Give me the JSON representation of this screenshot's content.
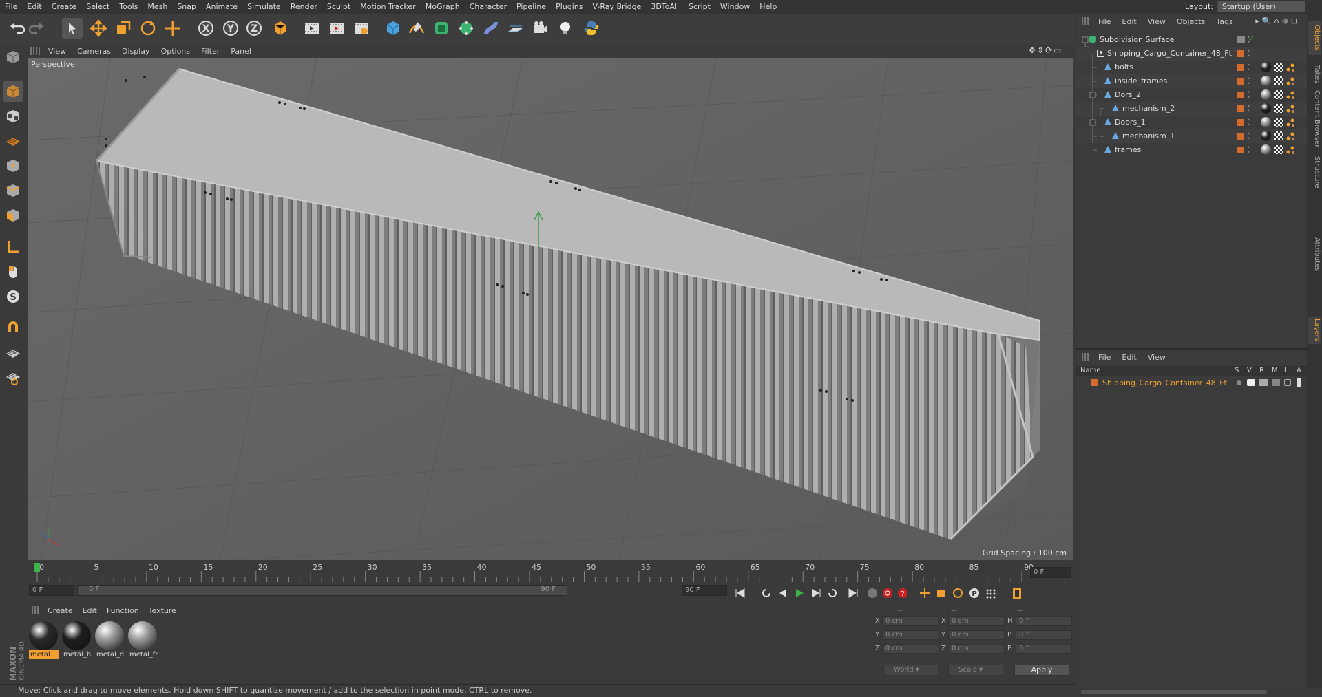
{
  "menubar": {
    "items": [
      "File",
      "Edit",
      "Create",
      "Select",
      "Tools",
      "Mesh",
      "Snap",
      "Animate",
      "Simulate",
      "Render",
      "Sculpt",
      "Motion Tracker",
      "MoGraph",
      "Character",
      "Pipeline",
      "Plugins",
      "V-Ray Bridge",
      "3DToAll",
      "Script",
      "Window",
      "Help"
    ],
    "layout_label": "Layout:",
    "layout_value": "Startup (User)"
  },
  "toolbar": {
    "icons": [
      "undo-icon",
      "redo-icon",
      "select-pointer-icon",
      "move-icon",
      "scale-icon",
      "rotate-icon",
      "transform-icon",
      "x-axis-lock-icon",
      "y-axis-lock-icon",
      "z-axis-lock-icon",
      "world-coord-icon",
      "render-view-icon",
      "render-picture-viewer-icon",
      "render-settings-icon",
      "cube-primitive-icon",
      "pen-spline-icon",
      "subdivision-nurbs-icon",
      "array-mograph-icon",
      "deformer-icon",
      "floor-environment-icon",
      "camera-icon",
      "light-icon",
      "python-icon"
    ],
    "axis_labels": [
      "X",
      "Y",
      "Z"
    ]
  },
  "viewport": {
    "menu": [
      "View",
      "Cameras",
      "Display",
      "Options",
      "Filter",
      "Panel"
    ],
    "label": "Perspective",
    "grid_spacing": "Grid Spacing : 100 cm"
  },
  "timeline": {
    "ticks": [
      "0",
      "5",
      "10",
      "15",
      "20",
      "25",
      "30",
      "35",
      "40",
      "45",
      "50",
      "55",
      "60",
      "65",
      "70",
      "75",
      "80",
      "85",
      "90"
    ],
    "current_frame": "0 F"
  },
  "playbar": {
    "start": "0 F",
    "range_start": "0 F",
    "range_end": "90 F",
    "end": "90 F"
  },
  "materials": {
    "menu": [
      "Create",
      "Edit",
      "Function",
      "Texture"
    ],
    "items": [
      {
        "name": "metal",
        "color": "#2a2a2a",
        "selected": true
      },
      {
        "name": "metal_b",
        "color": "#1e1e1e",
        "selected": false
      },
      {
        "name": "metal_d",
        "color": "#9a9a9a",
        "selected": false
      },
      {
        "name": "metal_fr",
        "color": "#9c9c9c",
        "selected": false
      }
    ]
  },
  "coords": {
    "header": [
      "--",
      "--",
      "--"
    ],
    "rows": [
      {
        "a": "X",
        "av": "0 cm",
        "b": "X",
        "bv": "0 cm",
        "c": "H",
        "cv": "0 °"
      },
      {
        "a": "Y",
        "av": "0 cm",
        "b": "Y",
        "bv": "0 cm",
        "c": "P",
        "cv": "0 °"
      },
      {
        "a": "Z",
        "av": "0 cm",
        "b": "Z",
        "bv": "0 cm",
        "c": "B",
        "cv": "0 °"
      }
    ],
    "mode_world": "World",
    "mode_scale": "Scale",
    "apply": "Apply"
  },
  "status": "Move: Click and drag to move elements. Hold down SHIFT to quantize movement / add to the selection in point mode, CTRL to remove.",
  "objects": {
    "menu": [
      "File",
      "Edit",
      "View",
      "Objects",
      "Tags"
    ],
    "rows": [
      {
        "name": "Subdivision Surface",
        "indent": 0,
        "icon": "subdivision-icon",
        "tags": false
      },
      {
        "name": "Shipping_Cargo_Container_48_Ft",
        "indent": 1,
        "icon": "null-object-icon",
        "tags": false
      },
      {
        "name": "bolts",
        "indent": 2,
        "icon": "polygon-icon",
        "tags": true,
        "ball": "dark"
      },
      {
        "name": "inside_frames",
        "indent": 2,
        "icon": "polygon-icon",
        "tags": true,
        "ball": "grey"
      },
      {
        "name": "Dors_2",
        "indent": 2,
        "icon": "polygon-icon",
        "tags": true,
        "ball": "grey"
      },
      {
        "name": "mechanism_2",
        "indent": 3,
        "icon": "polygon-icon",
        "tags": true,
        "ball": "dark"
      },
      {
        "name": "Doors_1",
        "indent": 2,
        "icon": "polygon-icon",
        "tags": true,
        "ball": "grey"
      },
      {
        "name": "mechanism_1",
        "indent": 3,
        "icon": "polygon-icon",
        "tags": true,
        "ball": "dark"
      },
      {
        "name": "frames",
        "indent": 2,
        "icon": "polygon-icon",
        "tags": true,
        "ball": "grey"
      }
    ]
  },
  "layers": {
    "menu": [
      "File",
      "Edit",
      "View"
    ],
    "columns": [
      "Name",
      "S",
      "V",
      "R",
      "M",
      "L",
      "A"
    ],
    "row": "Shipping_Cargo_Container_48_Ft"
  },
  "right_tabs": [
    "Objects",
    "Takes",
    "Content Browser",
    "Structure",
    "Attributes",
    "Layers"
  ],
  "brand": {
    "maxon": "MAXON",
    "product": "CINEMA 4D"
  },
  "accent": "#f0a030"
}
